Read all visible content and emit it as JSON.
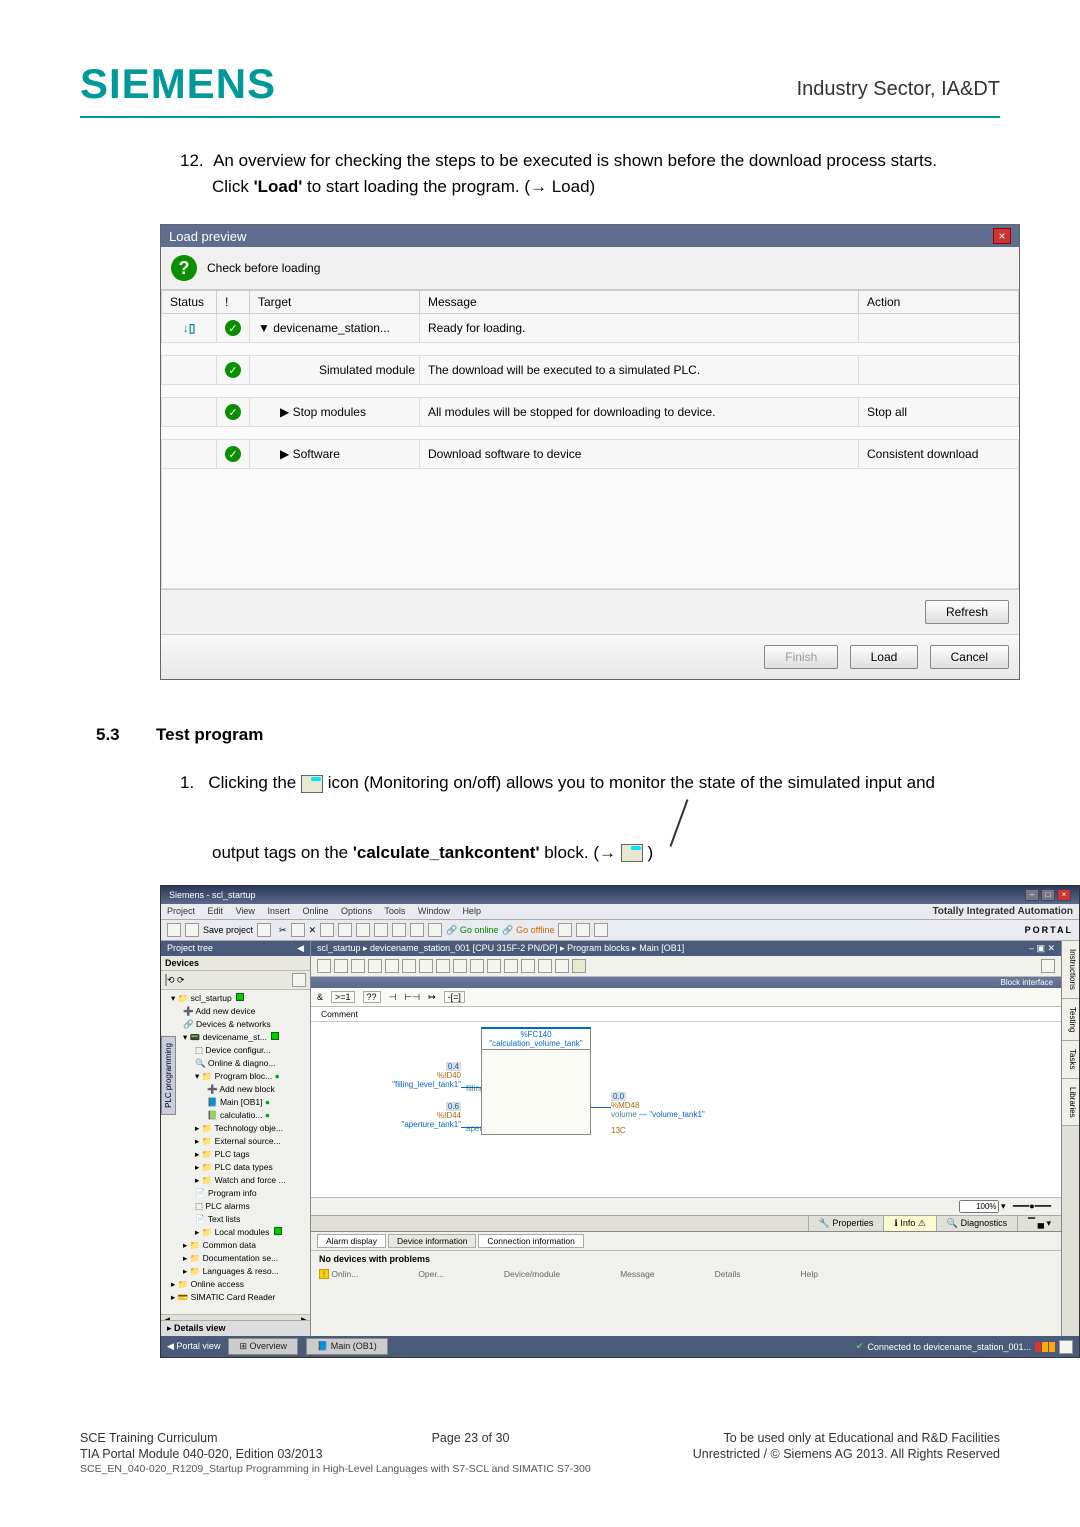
{
  "header": {
    "logo": "SIEMENS",
    "right": "Industry Sector, IA&DT"
  },
  "step12": {
    "num": "12.",
    "line1": "An overview for checking the steps to be executed is shown before the download process starts.",
    "line2_a": "Click ",
    "line2_bold": "'Load'",
    "line2_b": " to start loading the program. (→ Load)"
  },
  "loadPreview": {
    "title": "Load preview",
    "checkLabel": "Check before loading",
    "headers": {
      "status": "Status",
      "excl": "!",
      "target": "Target",
      "message": "Message",
      "action": "Action"
    },
    "rows": [
      {
        "target": "▼  devicename_station...",
        "message": "Ready for loading.",
        "action": ""
      },
      {
        "target": "Simulated module",
        "message": "The download will be executed to a simulated PLC.",
        "action": ""
      },
      {
        "target": "▶  Stop modules",
        "message": "All modules will be stopped for downloading to device.",
        "action": "Stop all"
      },
      {
        "target": "▶  Software",
        "message": "Download software to device",
        "action": "Consistent download"
      }
    ],
    "refresh": "Refresh",
    "finish": "Finish",
    "load": "Load",
    "cancel": "Cancel"
  },
  "section53": {
    "num": "5.3",
    "title": "Test program"
  },
  "step1": {
    "num": "1.",
    "a": "Clicking the ",
    "b": " icon (Monitoring on/off) allows you to monitor the state of the simulated input and",
    "c_a": "output tags on the ",
    "c_bold": "'calculate_tankcontent'",
    "c_b": " block. (→ ",
    "c_c": " )"
  },
  "tia": {
    "title": "Siemens - scl_startup",
    "menu": [
      "Project",
      "Edit",
      "View",
      "Insert",
      "Online",
      "Options",
      "Tools",
      "Window",
      "Help"
    ],
    "branding": "Totally Integrated Automation",
    "portal": "PORTAL",
    "saveProject": "Save project",
    "goOnline": "Go online",
    "goOffline": "Go offline",
    "leftHeader": "Project tree",
    "devicesLabel": "Devices",
    "tree": {
      "root": "scl_startup",
      "addDevice": "Add new device",
      "devNet": "Devices & networks",
      "station": "devicename_st...",
      "devConfig": "Device configur...",
      "onlineDiag": "Online & diagno...",
      "progBlocks": "Program bloc...",
      "addBlock": "Add new block",
      "mainOb": "Main [OB1]",
      "calc": "calculatio...",
      "techObj": "Technology obje...",
      "extSrc": "External source...",
      "plcTags": "PLC tags",
      "plcTypes": "PLC data types",
      "watch": "Watch and force ...",
      "progInfo": "Program info",
      "plcAlarms": "PLC alarms",
      "textLists": "Text lists",
      "localMod": "Local modules",
      "commonData": "Common data",
      "docSettings": "Documentation se...",
      "langRes": "Languages & reso...",
      "onlineAccess": "Online access",
      "cardReader": "SIMATIC Card Reader"
    },
    "detailsView": "Details view",
    "breadcrumb": "scl_startup  ▸  devicename_station_001 [CPU 315F-2 PN/DP]  ▸  Program blocks  ▸  Main [OB1]",
    "blockInterface": "Block interface",
    "comment": "Comment",
    "canvas": {
      "sfc": "%FC140",
      "sfcName": "\"calculation_volume_tank\"",
      "in1addr": "0.4",
      "in1tag": "%ID40",
      "in1name": "\"filling_level_tank1\"",
      "in1port": "filling_level",
      "in2addr": "0.6",
      "in2tag": "%ID44",
      "in2name": "\"aperture_tank1\"",
      "in2port": "aperture",
      "outname": "\"volume_tank1\"",
      "outtag": "%MD48",
      "outaddr": "0.0",
      "outport": "volume",
      "retval": "13C"
    },
    "zoom": "100%",
    "tabsB": {
      "props": "Properties",
      "info": "Info",
      "diag": "Diagnostics"
    },
    "lowerTabs": [
      "Alarm display",
      "Device information",
      "Connection information"
    ],
    "noDevices": "No devices with problems",
    "lowerCols": [
      "Onlin...",
      "Oper...",
      "Device/module",
      "Message",
      "Details",
      "Help"
    ],
    "rightTabs": [
      "Instructions",
      "Testing",
      "Tasks",
      "Libraries"
    ],
    "leftSidebarTab": "PLC programming",
    "statusLeft": "Portal view",
    "statusMid1": "Overview",
    "statusMid2": "Main (OB1)",
    "statusRight": "Connected to devicename_station_001..."
  },
  "footer": {
    "l1a": "SCE Training Curriculum",
    "l1b": "Page 23 of 30",
    "l1c": "To be used only at Educational and R&D Facilities",
    "l2a": "TIA Portal Module 040-020, Edition 03/2013",
    "l2b": "Unrestricted / © Siemens AG 2013. All Rights Reserved",
    "l3": "SCE_EN_040-020_R1209_Startup Programming in High-Level Languages with S7-SCL and SIMATIC S7-300"
  }
}
